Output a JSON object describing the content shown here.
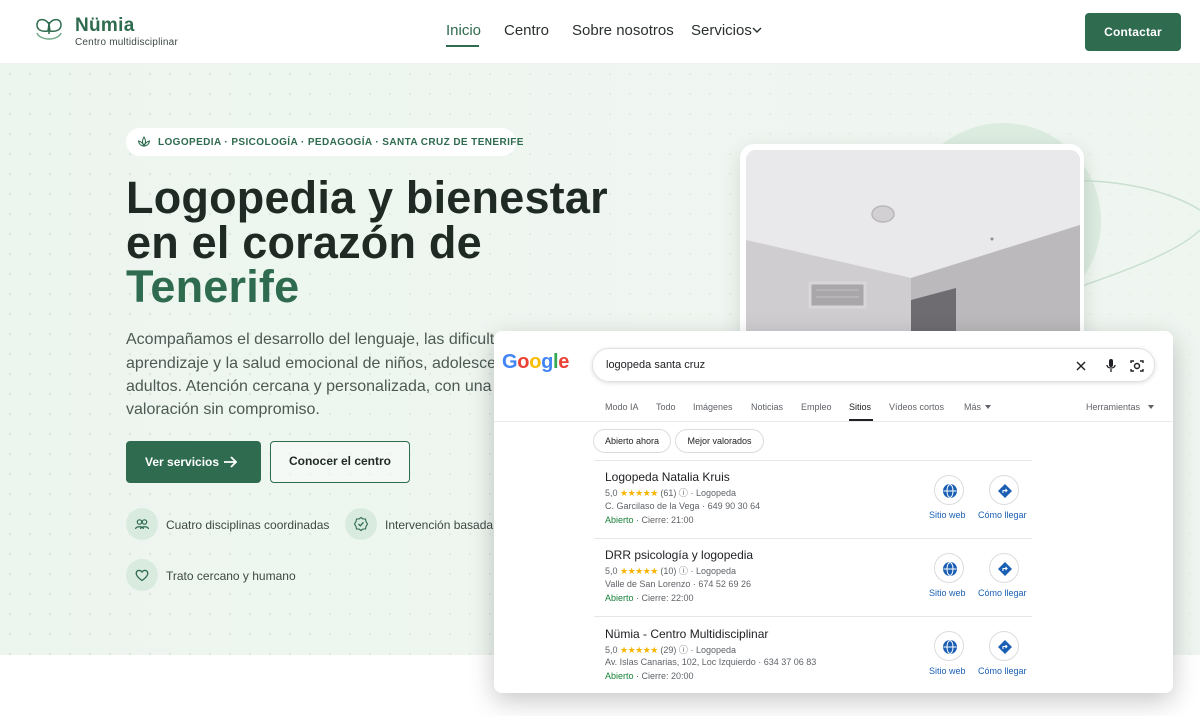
{
  "header": {
    "brand_name": "Nümia",
    "brand_tagline": "Centro multidisciplinar",
    "nav": [
      "Inicio",
      "Centro",
      "Sobre nosotros",
      "Servicios"
    ],
    "active_nav": "Inicio",
    "contact_label": "Contactar"
  },
  "hero": {
    "badge": "LOGOPEDIA · PSICOLOGÍA · PEDAGOGÍA · SANTA CRUZ DE TENERIFE",
    "title_line1": "Logopedia y bienestar",
    "title_line2": "en el corazón de",
    "title_highlight": "Tenerife",
    "lead_lines": [
      "Acompañamos el desarrollo del lenguaje, las dificultades",
      "aprendizaje y la salud emocional de niños, adolescentes",
      "adultos. Atención cercana y personalizada, con una prim",
      "valoración sin compromiso."
    ],
    "primary_cta": "Ver servicios",
    "secondary_cta": "Conocer el centro",
    "features": [
      {
        "label": "Cuatro disciplinas coordinadas",
        "icon": "people-icon"
      },
      {
        "label": "Intervención basada e",
        "icon": "check-badge-icon"
      },
      {
        "label": "Trato cercano y humano",
        "icon": "heart-icon"
      }
    ]
  },
  "google": {
    "logo": "Google",
    "query": "logopeda santa cruz",
    "tabs": [
      "Modo IA",
      "Todo",
      "Imágenes",
      "Noticias",
      "Empleo",
      "Sitios",
      "Vídeos cortos",
      "Más"
    ],
    "active_tab": "Sitios",
    "tools": "Herramientas",
    "chips": [
      "Abierto ahora",
      "Mejor valorados"
    ],
    "website_label": "Sitio web",
    "directions_label": "Cómo llegar",
    "results": [
      {
        "name": "Logopeda Natalia Kruis",
        "rating": "5,0",
        "reviews": "(61)",
        "category": "Logopeda",
        "address": "C. Garcilaso de la Vega",
        "phone": "649 90 30 64",
        "status": "Abierto",
        "closes": "Cierre: 21:00"
      },
      {
        "name": "DRR psicología y logopedia",
        "rating": "5,0",
        "reviews": "(10)",
        "category": "Logopeda",
        "address": "Valle de San Lorenzo",
        "phone": "674 52 69 26",
        "status": "Abierto",
        "closes": "Cierre: 22:00"
      },
      {
        "name": "Nümia - Centro Multidisciplinar",
        "rating": "5,0",
        "reviews": "(29)",
        "category": "Logopeda",
        "address": "Av. Islas Canarias, 102, Loc Izquierdo",
        "phone": "634 37 06 83",
        "status": "Abierto",
        "closes": "Cierre: 20:00"
      }
    ]
  },
  "colors": {
    "brand": "#2f6b4f",
    "hero_bg": "#edf5ef",
    "google_link": "#1a5fb4",
    "open_green": "#188038",
    "star": "#f6b400"
  }
}
